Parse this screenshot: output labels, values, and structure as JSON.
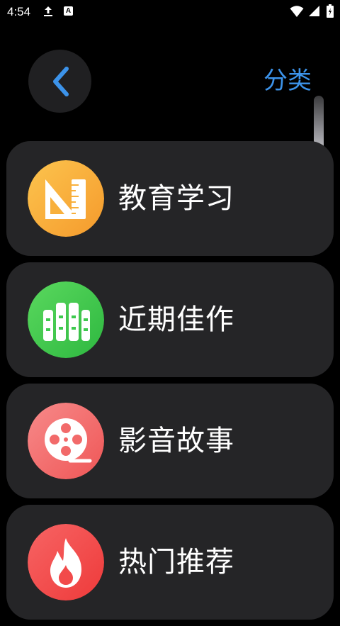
{
  "status_bar": {
    "time": "4:54",
    "icons": [
      "upload-icon",
      "a-notification-icon",
      "wifi-icon",
      "signal-icon",
      "battery-icon"
    ],
    "a_glyph": "A"
  },
  "header": {
    "back_icon": "chevron-left-icon",
    "title": "分类",
    "accent_color": "#3c93ea"
  },
  "categories": [
    {
      "label": "教育学习",
      "icon": "ruler-triangle-icon",
      "color": "#f8b03c"
    },
    {
      "label": "近期佳作",
      "icon": "books-icon",
      "color": "#3ec94e"
    },
    {
      "label": "影音故事",
      "icon": "film-reel-icon",
      "color": "#f26a6a"
    },
    {
      "label": "热门推荐",
      "icon": "flame-icon",
      "color": "#f24a4a"
    }
  ]
}
